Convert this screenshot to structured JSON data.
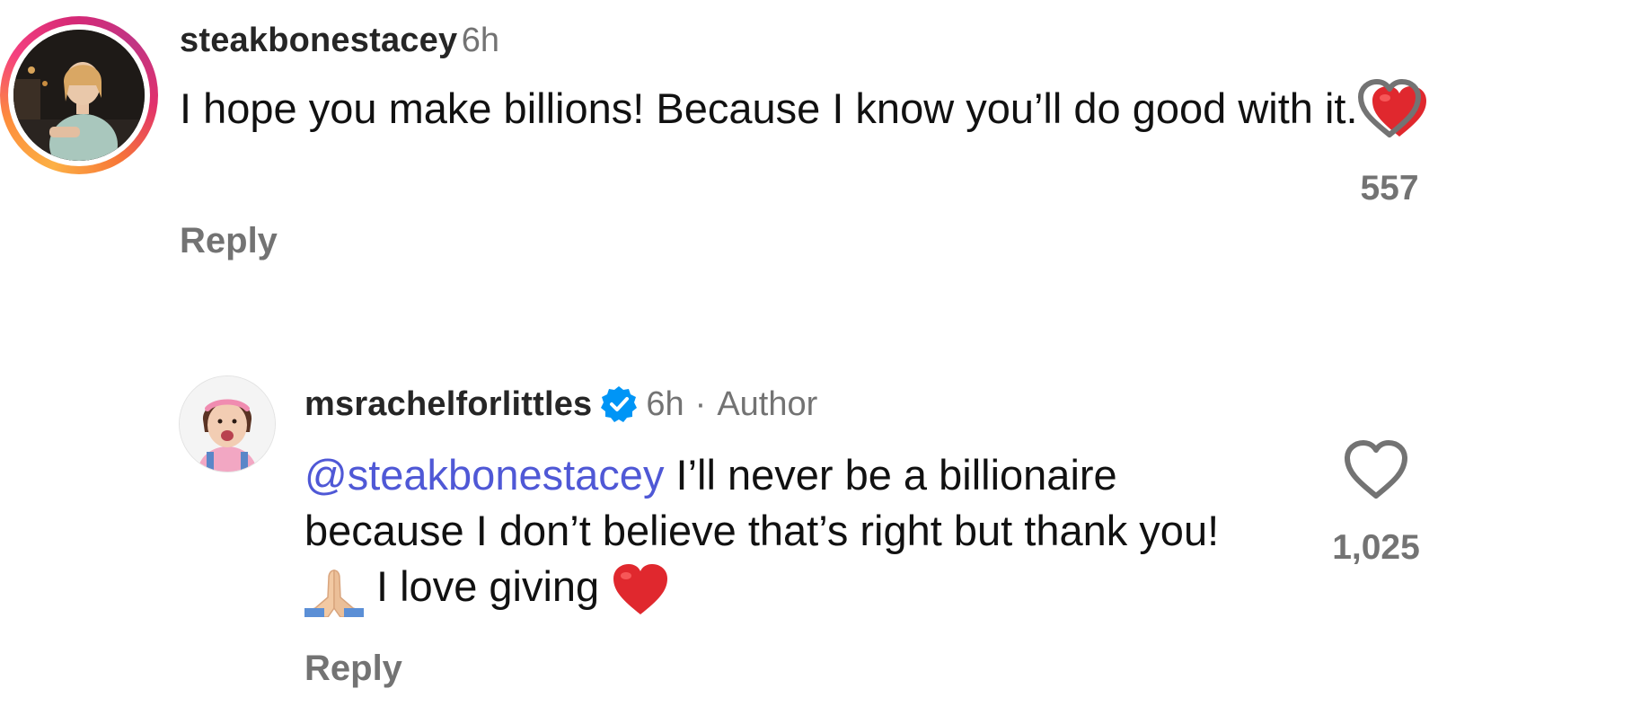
{
  "comments": [
    {
      "username": "steakbonestacey",
      "time": "6h",
      "text": "I hope you make billions! Because I know you’ll do good with it.",
      "emoji_end": "red-heart",
      "reply_label": "Reply",
      "likes": "557",
      "story_ring": true
    },
    {
      "username": "msrachelforlittles",
      "verified": true,
      "time": "6h",
      "separator": "·",
      "author_label": "Author",
      "mention": "@steakbonestacey",
      "text_line1": " I’ll never be a billionaire",
      "text_line2": "because I don’t believe that’s right but thank you!",
      "text_line3": "I love giving",
      "emoji_start": "folded-hands",
      "emoji_end": "red-heart",
      "reply_label": "Reply",
      "likes": "1,025"
    }
  ],
  "colors": {
    "mention": "#4f58d6",
    "muted": "#737373",
    "verified": "#0095f6",
    "heart": "#e0282e"
  }
}
